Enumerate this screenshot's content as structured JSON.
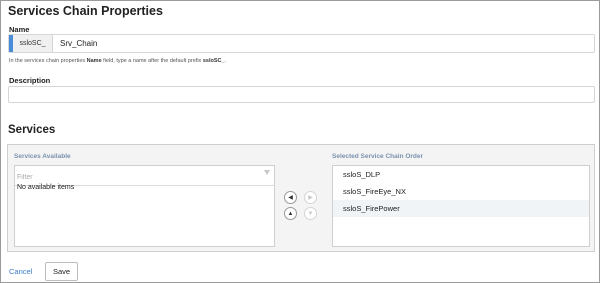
{
  "properties": {
    "title": "Services Chain Properties",
    "name_label": "Name",
    "name_prefix": "ssloSC_",
    "name_value": "Srv_Chain",
    "hint_prefix": "In the services chain properties ",
    "hint_bold_name": "Name",
    "hint_middle": " field, type a name after the default prefix ",
    "hint_bold_prefix": "ssloSC_",
    "hint_suffix": ".",
    "description_label": "Description",
    "description_value": ""
  },
  "services": {
    "title": "Services",
    "available": {
      "title": "Services Available",
      "filter_placeholder": "Filter",
      "empty_text": "No available items"
    },
    "selected": {
      "title": "Selected Service Chain Order",
      "items": [
        {
          "label": "ssloS_DLP"
        },
        {
          "label": "ssloS_FireEye_NX"
        },
        {
          "label": "ssloS_FirePower"
        }
      ]
    },
    "move_buttons": {
      "left": "◀",
      "right": "▶",
      "up": "▲",
      "down": "▼"
    }
  },
  "footer": {
    "cancel_label": "Cancel",
    "save_label": "Save"
  },
  "colors": {
    "accent": "#4a8cd8",
    "link": "#3b7cc4",
    "column_title": "#7a92ae"
  }
}
